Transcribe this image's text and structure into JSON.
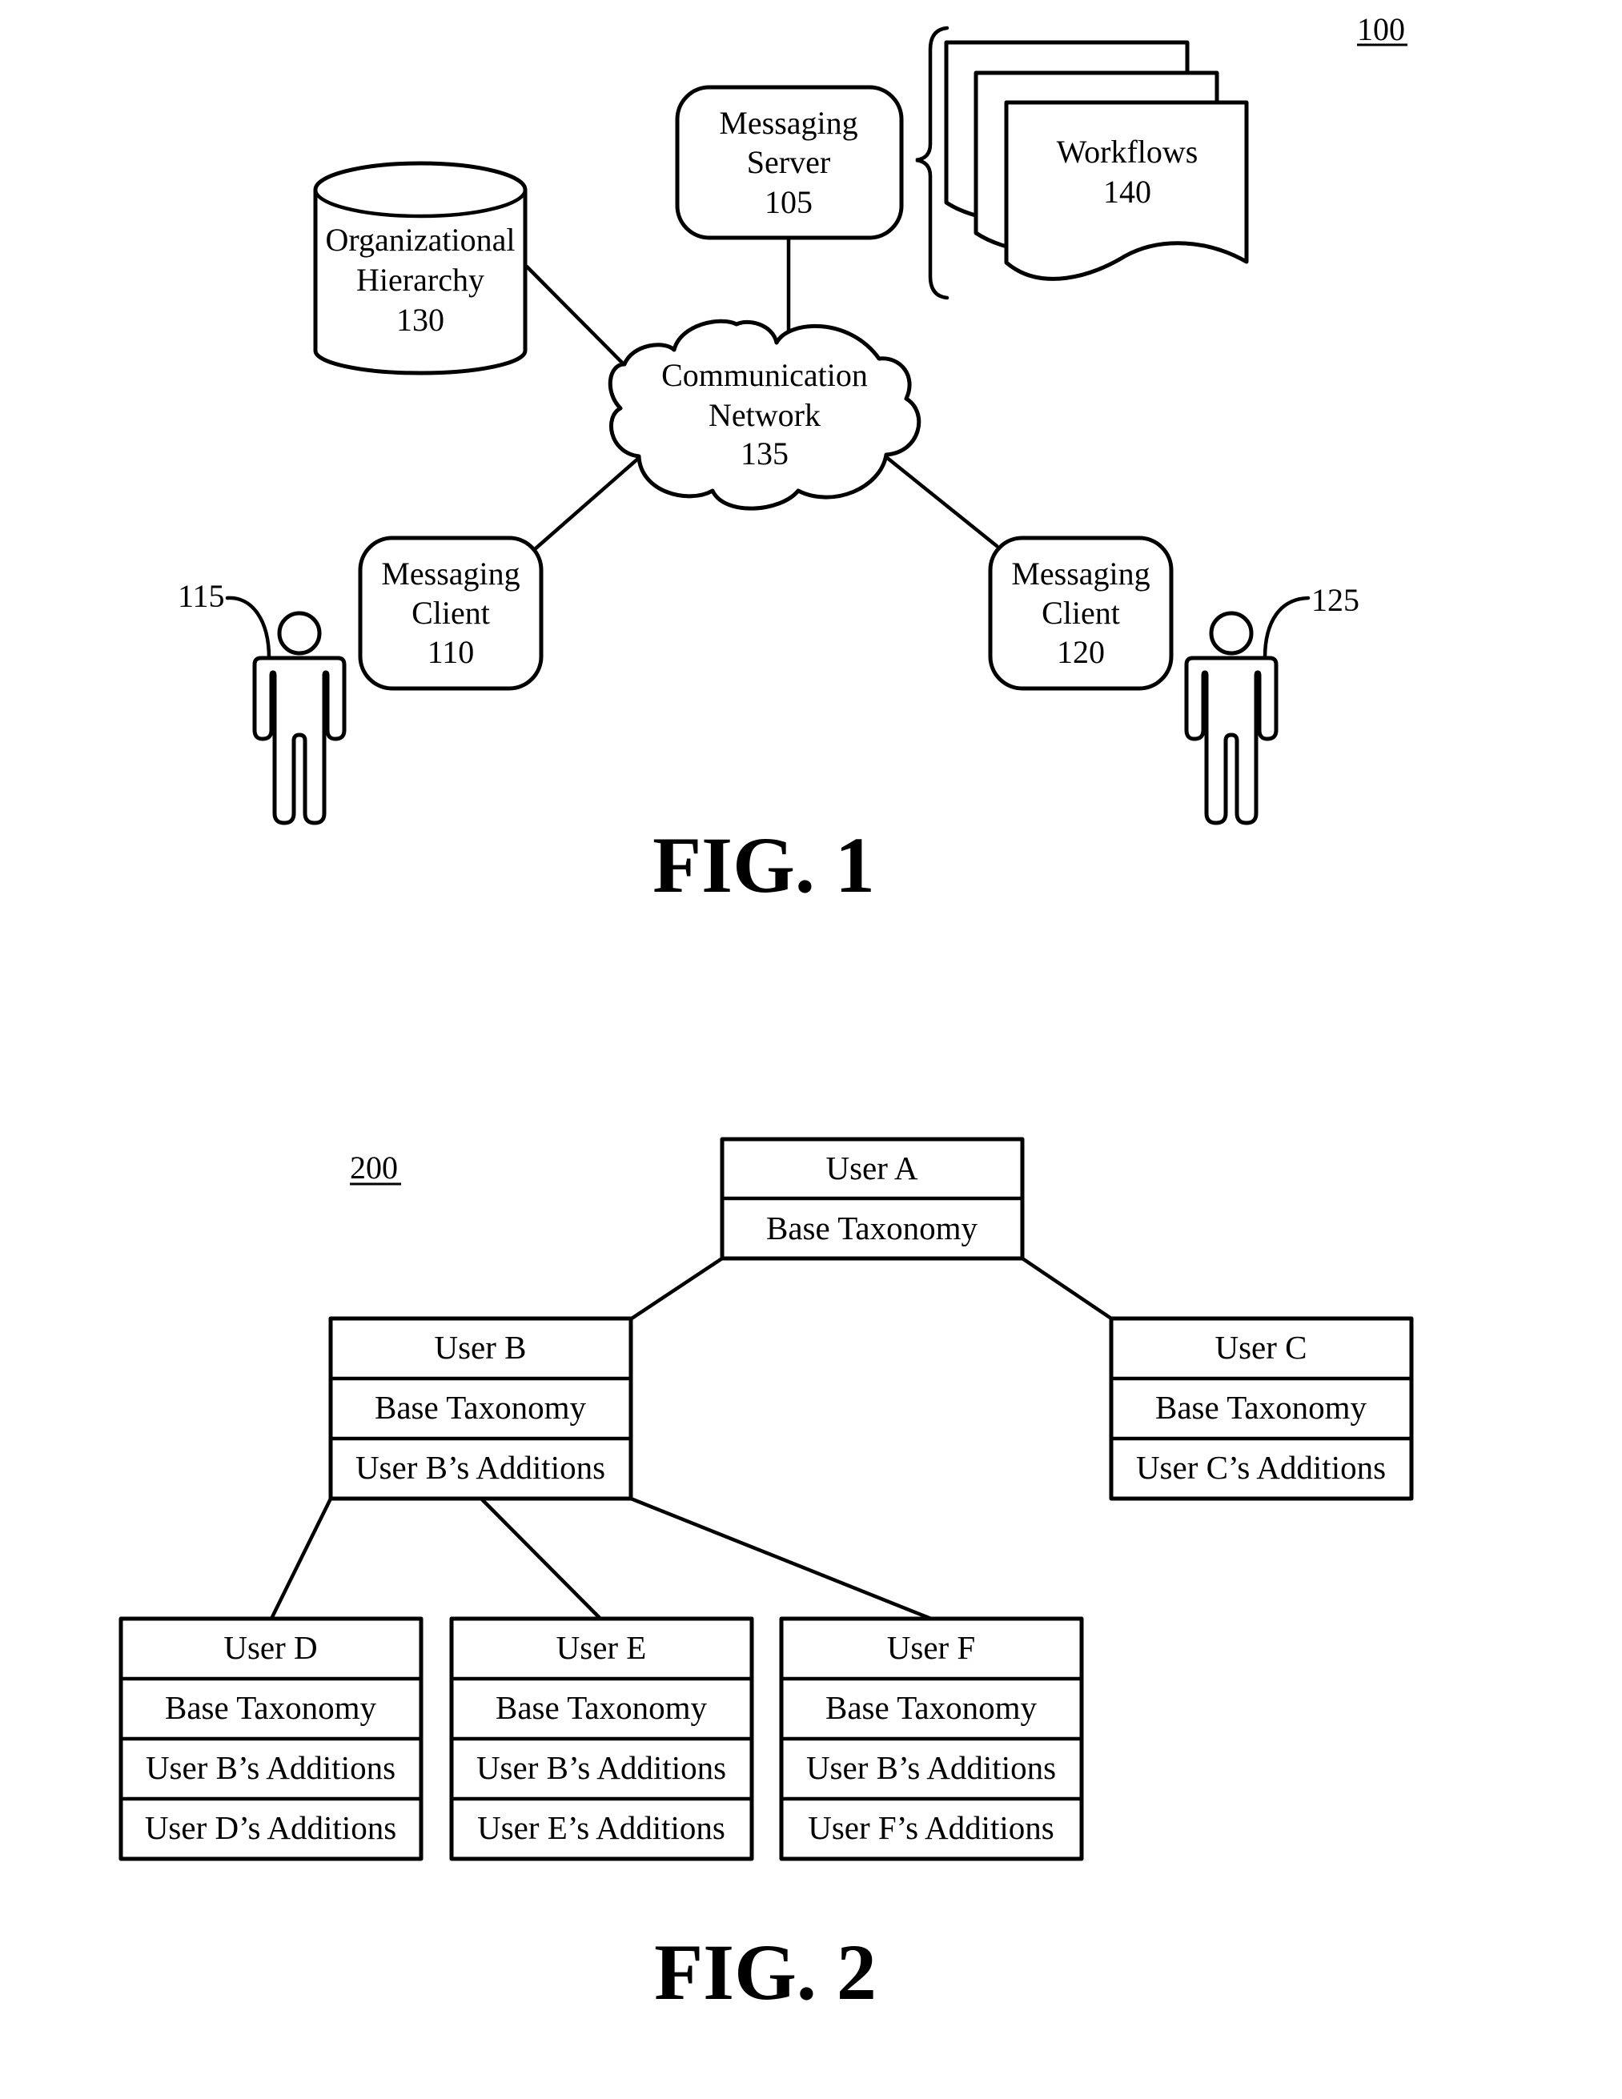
{
  "figure1": {
    "reference_label": "100",
    "caption": "FIG. 1",
    "messaging_server": {
      "lines": [
        "Messaging",
        "Server",
        "105"
      ]
    },
    "workflows": {
      "lines": [
        "Workflows",
        "140"
      ]
    },
    "organizational_hierarchy": {
      "lines": [
        "Organizational",
        "Hierarchy",
        "130"
      ]
    },
    "communication_network": {
      "lines": [
        "Communication",
        "Network",
        "135"
      ]
    },
    "messaging_client_left": {
      "lines": [
        "Messaging",
        "Client",
        "110"
      ]
    },
    "messaging_client_right": {
      "lines": [
        "Messaging",
        "Client",
        "120"
      ]
    },
    "user_left": {
      "reference_label": "115"
    },
    "user_right": {
      "reference_label": "125"
    }
  },
  "figure2": {
    "reference_label": "200",
    "caption": "FIG. 2",
    "nodes": {
      "user_a": {
        "rows": [
          "User A",
          "Base Taxonomy"
        ]
      },
      "user_b": {
        "rows": [
          "User B",
          "Base Taxonomy",
          "User B’s Additions"
        ]
      },
      "user_c": {
        "rows": [
          "User C",
          "Base Taxonomy",
          "User C’s Additions"
        ]
      },
      "user_d": {
        "rows": [
          "User D",
          "Base Taxonomy",
          "User B’s Additions",
          "User D’s Additions"
        ]
      },
      "user_e": {
        "rows": [
          "User E",
          "Base Taxonomy",
          "User B’s Additions",
          "User E’s Additions"
        ]
      },
      "user_f": {
        "rows": [
          "User F",
          "Base Taxonomy",
          "User B’s Additions",
          "User F’s Additions"
        ]
      }
    },
    "edges": [
      {
        "from": "User A",
        "to": "User B"
      },
      {
        "from": "User A",
        "to": "User C"
      },
      {
        "from": "User B",
        "to": "User D"
      },
      {
        "from": "User B",
        "to": "User E"
      },
      {
        "from": "User B",
        "to": "User F"
      }
    ]
  }
}
